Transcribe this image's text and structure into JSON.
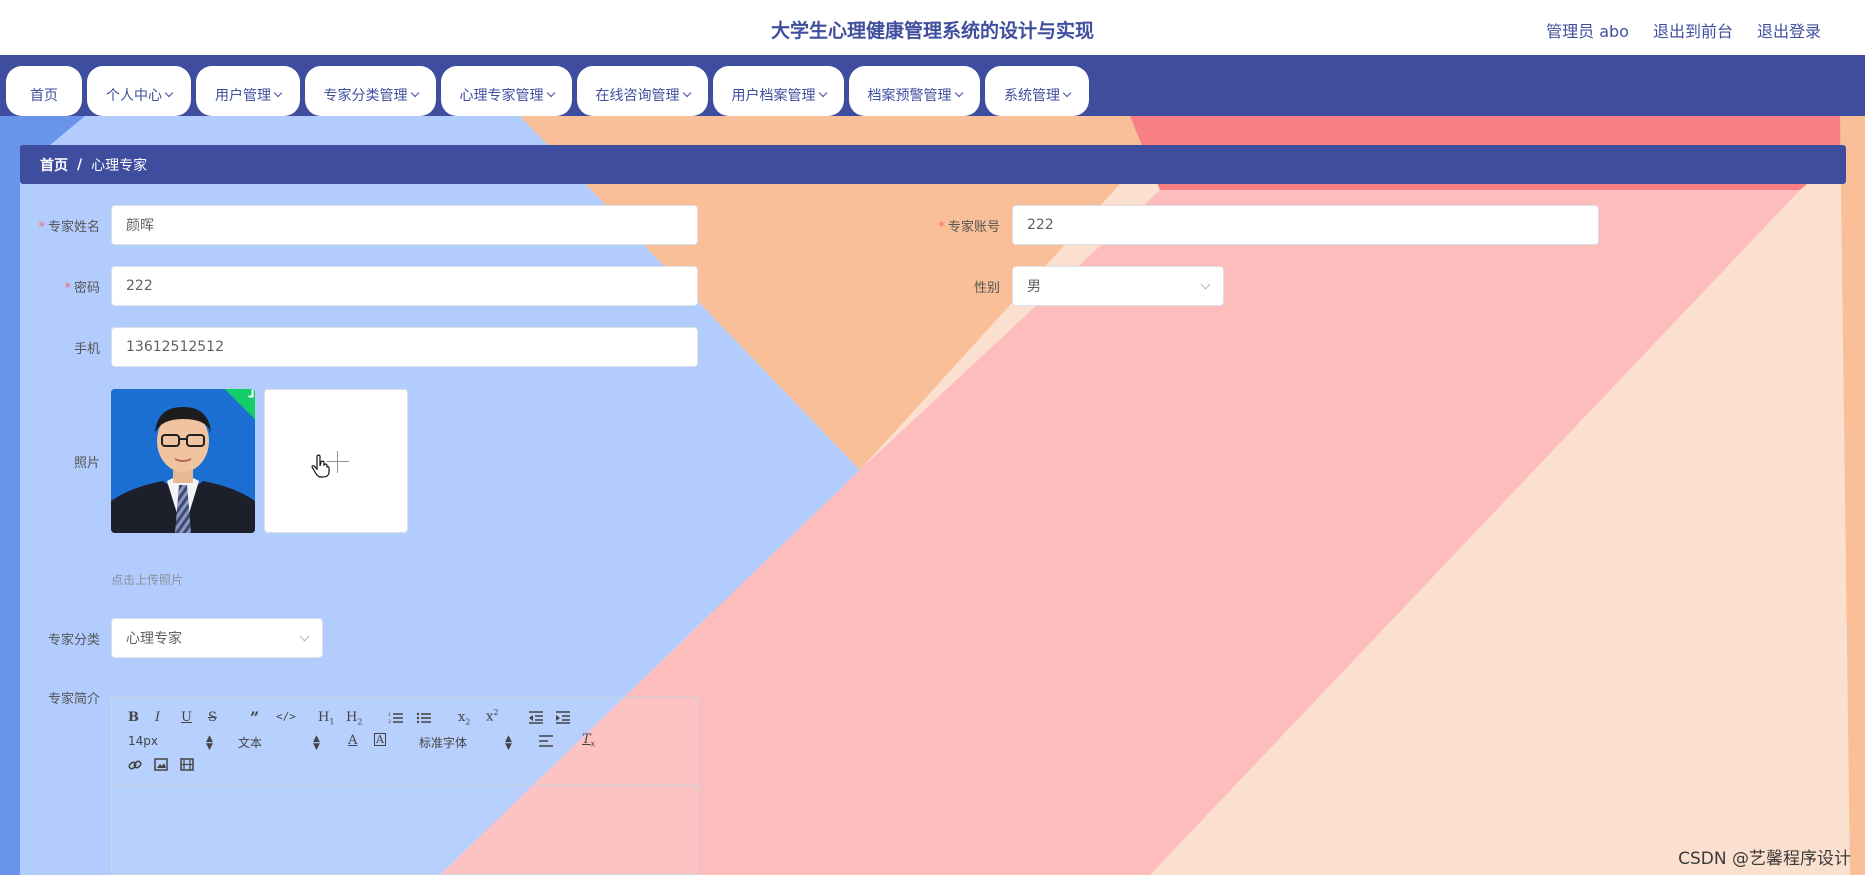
{
  "header": {
    "title": "大学生心理健康管理系统的设计与实现",
    "admin": "管理员 abo",
    "back_front": "退出到前台",
    "logout": "退出登录"
  },
  "nav": {
    "items": [
      {
        "label": "首页",
        "has_dropdown": false
      },
      {
        "label": "个人中心",
        "has_dropdown": true
      },
      {
        "label": "用户管理",
        "has_dropdown": true
      },
      {
        "label": "专家分类管理",
        "has_dropdown": true
      },
      {
        "label": "心理专家管理",
        "has_dropdown": true
      },
      {
        "label": "在线咨询管理",
        "has_dropdown": true
      },
      {
        "label": "用户档案管理",
        "has_dropdown": true
      },
      {
        "label": "档案预警管理",
        "has_dropdown": true
      },
      {
        "label": "系统管理",
        "has_dropdown": true
      }
    ]
  },
  "breadcrumb": {
    "home": "首页",
    "separator": "/",
    "current": "心理专家"
  },
  "form": {
    "name_label": "专家姓名",
    "name_value": "颜晖",
    "account_label": "专家账号",
    "account_value": "222",
    "password_label": "密码",
    "password_value": "222",
    "gender_label": "性别",
    "gender_value": "男",
    "phone_label": "手机",
    "phone_value": "13612512512",
    "photo_label": "照片",
    "upload_tip": "点击上传照片",
    "category_label": "专家分类",
    "category_value": "心理专家",
    "intro_label": "专家简介",
    "required_mark": "*"
  },
  "editor": {
    "font_size": "14px",
    "text_type": "文本",
    "font_family": "标准字体"
  },
  "watermark": "CSDN @艺馨程序设计",
  "colors": {
    "primary": "#3f4d9f",
    "title": "#3f4f9e",
    "required": "#f56c6c",
    "success": "#13ce66"
  }
}
